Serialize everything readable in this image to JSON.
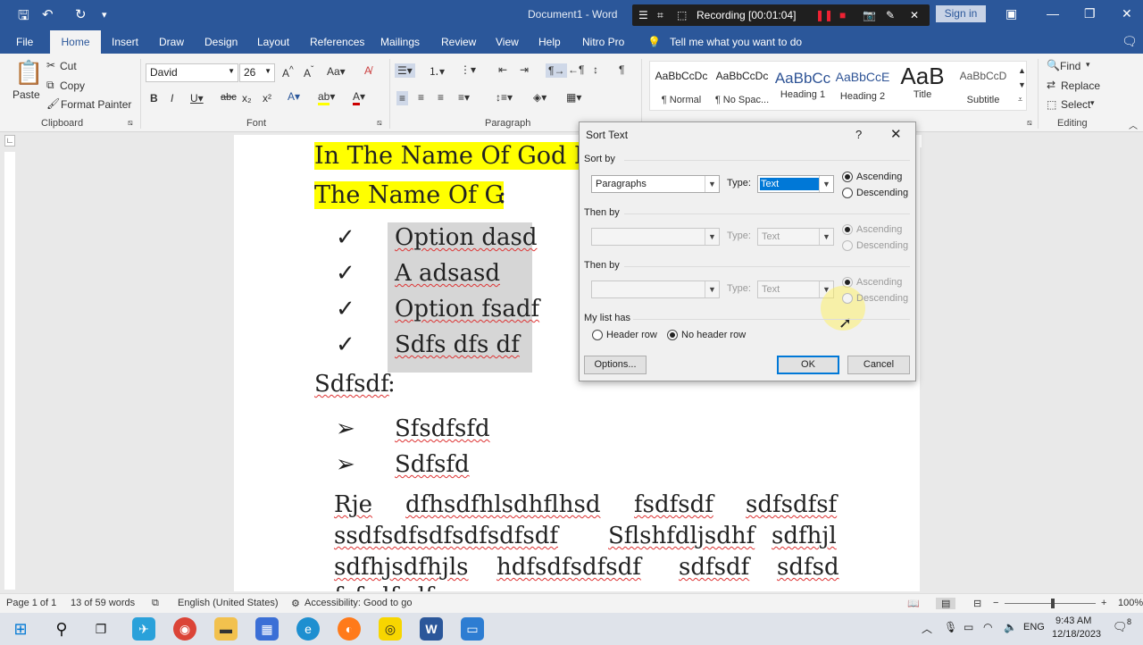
{
  "titlebar": {
    "doc_title": "Document1 - Word",
    "recording": "Recording [00:01:04]",
    "signin": "Sign in"
  },
  "tabs": [
    "File",
    "Home",
    "Insert",
    "Draw",
    "Design",
    "Layout",
    "References",
    "Mailings",
    "Review",
    "View",
    "Help",
    "Nitro Pro"
  ],
  "tell_me": "Tell me what you want to do",
  "ribbon": {
    "clipboard": {
      "paste": "Paste",
      "cut": "Cut",
      "copy": "Copy",
      "format_painter": "Format Painter",
      "group": "Clipboard"
    },
    "font": {
      "name": "David",
      "size": "26",
      "group": "Font"
    },
    "paragraph_group": "Paragraph",
    "styles": [
      {
        "preview": "AaBbCcDc",
        "name": "¶ Normal"
      },
      {
        "preview": "AaBbCcDc",
        "name": "¶ No Spac..."
      },
      {
        "preview": "AaBbCc",
        "name": "Heading 1"
      },
      {
        "preview": "AaBbCcE",
        "name": "Heading 2"
      },
      {
        "preview": "AaB",
        "name": "Title"
      },
      {
        "preview": "AaBbCcD",
        "name": "Subtitle"
      }
    ],
    "editing": {
      "find": "Find",
      "replace": "Replace",
      "select": "Select",
      "group": "Editing"
    }
  },
  "document": {
    "line1": "In The Name Of God I",
    "line2": "The Name Of G",
    "line2_colon": ":",
    "checks": [
      "Option dasd",
      "A adsasd",
      "Option fsadf",
      "Sdfs dfs df"
    ],
    "sdfsdf": "Sdfsdf",
    "sdfsdf_colon": ":",
    "arrows": [
      "Sfsdfsfd",
      "Sdfsfd"
    ],
    "para": [
      "Rje",
      "dfhsdfhlsdhflhsd",
      "fsdfsdf",
      "sdfsdfsf",
      "ssdfsdfsdfsdfsdfsdf",
      "Sflshfdljsdhf",
      "sdfhjl",
      "sdfhjsdfhjls",
      "hdfsdfsdfsdf",
      "sdfsdf",
      "sdfsd",
      "fsfsdfsdf"
    ]
  },
  "status": {
    "page": "Page 1 of 1",
    "words": "13 of 59 words",
    "lang": "English (United States)",
    "access": "Accessibility: Good to go",
    "zoom": "100%"
  },
  "taskbar": {
    "lang": "ENG",
    "time": "9:43 AM",
    "date": "12/18/2023",
    "notif": "8"
  },
  "dialog": {
    "title": "Sort Text",
    "help": "?",
    "sort_by": "Sort by",
    "then_by": "Then by",
    "then_by2": "Then by",
    "sort_field": "Paragraphs",
    "type_label": "Type:",
    "type1": "Text",
    "type2": "Text",
    "type3": "Text",
    "ascending": "Ascending",
    "descending": "Descending",
    "my_list_has": "My list has",
    "header_row": "Header row",
    "no_header_row": "No header row",
    "options": "Options...",
    "ok": "OK",
    "cancel": "Cancel"
  }
}
